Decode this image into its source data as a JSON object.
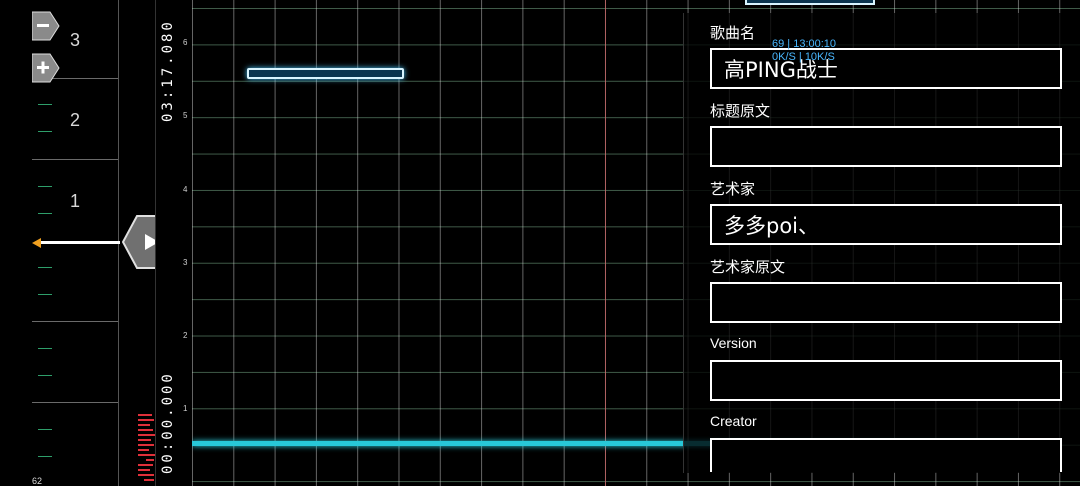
{
  "ruler": {
    "measures": [
      "3",
      "2",
      "1"
    ],
    "corner_value": "62",
    "zoom_out_label": "−",
    "zoom_in_label": "+"
  },
  "timeline": {
    "end_time": "03:17.080",
    "start_time": "00:00.000",
    "lane_numbers": [
      "6",
      "5",
      "4",
      "3",
      "2",
      "1"
    ]
  },
  "status_overlay": {
    "line1": "69 | 13:00:10",
    "line2": "0K/S | 10K/S"
  },
  "metadata": {
    "song_name_label": "歌曲名",
    "song_name_value": "高PING战士",
    "title_original_label": "标题原文",
    "title_original_value": "",
    "artist_label": "艺术家",
    "artist_value": "多多poi、",
    "artist_original_label": "艺术家原文",
    "artist_original_value": "",
    "version_label": "Version",
    "version_value": "",
    "creator_label": "Creator",
    "creator_value": ""
  },
  "colors": {
    "accent_cyan": "#28c8d8",
    "playhead_marker": "#f0a020",
    "note_outline": "#d8f4ff",
    "center_line": "#c06060"
  },
  "icons": {
    "zoom_out": "minus-icon",
    "zoom_in": "plus-icon",
    "play": "play-icon"
  }
}
